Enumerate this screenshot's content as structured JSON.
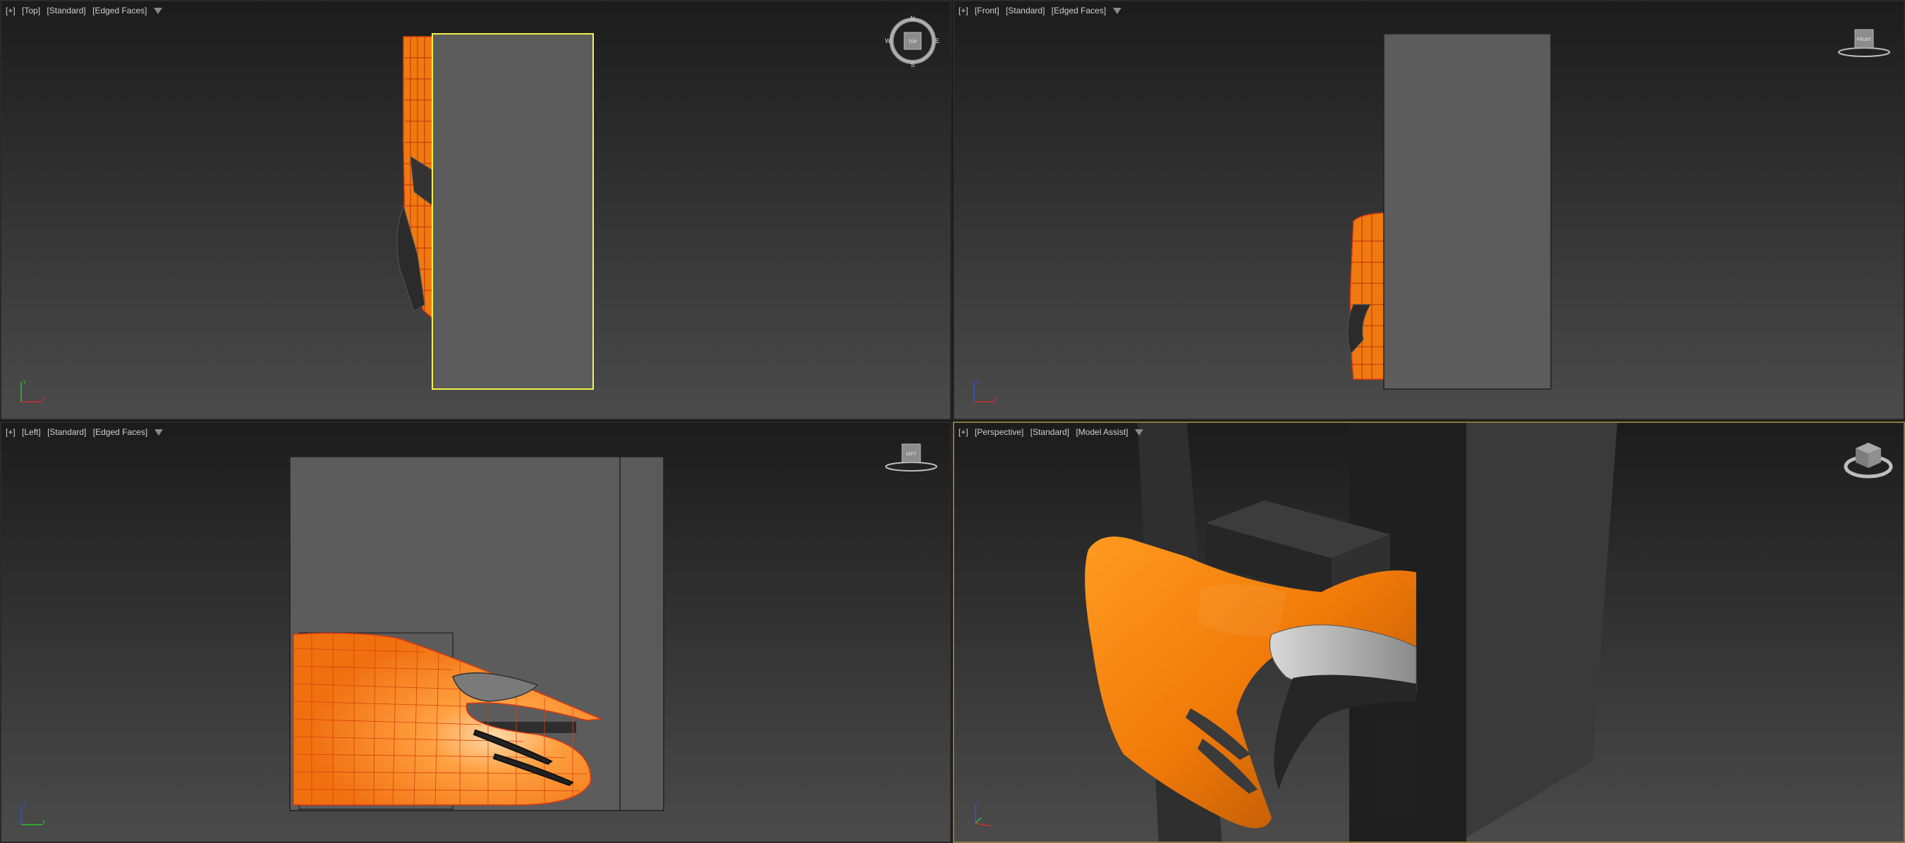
{
  "viewports": {
    "top": {
      "labels": [
        "[+]",
        "[Top]",
        "[Standard]",
        "[Edged Faces]"
      ],
      "compass": {
        "n": "N",
        "s": "S",
        "e": "E",
        "w": "W",
        "cube_face": "TOP"
      }
    },
    "front": {
      "labels": [
        "[+]",
        "[Front]",
        "[Standard]",
        "[Edged Faces]"
      ],
      "cube_face": "FRONT"
    },
    "left": {
      "labels": [
        "[+]",
        "[Left]",
        "[Standard]",
        "[Edged Faces]"
      ],
      "cube_face": "LEFT"
    },
    "perspective": {
      "labels": [
        "[+]",
        "[Perspective]",
        "[Standard]",
        "[Model Assist]"
      ]
    }
  },
  "axis_letters": {
    "x": "x",
    "y": "y",
    "z": "z"
  },
  "colors": {
    "model_orange": "#f07a10",
    "wire_red": "#e03a10",
    "selection_yellow": "#f2f24a",
    "active_border": "#8a7a3a",
    "box_gray": "#5c5c5c"
  }
}
